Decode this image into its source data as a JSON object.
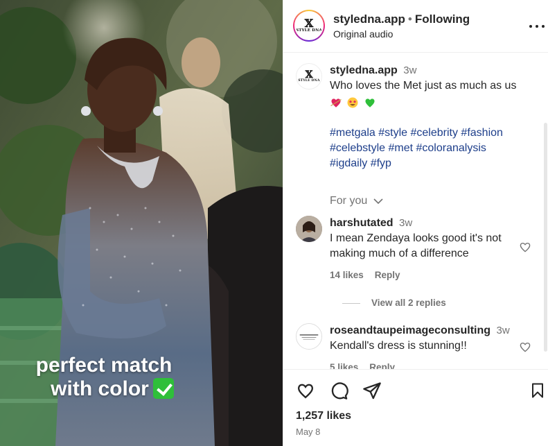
{
  "media": {
    "overlay_line1": "perfect match",
    "overlay_line2": "with color",
    "overlay_emoji": "check-mark-button"
  },
  "header": {
    "username": "styledna.app",
    "separator": "•",
    "follow_state": "Following",
    "audio": "Original audio",
    "logo_text": "STYLE DNA",
    "logo_mark": "ẍ"
  },
  "post": {
    "username": "styledna.app",
    "time": "3w",
    "text": "Who loves the Met just as much as us",
    "emojis": [
      "heart-with-arrow",
      "star-struck",
      "green-heart"
    ],
    "hashtags_line1": "#metgala #style #celebrity #fashion",
    "hashtags_line2": "#celebstyle #met #coloranalysis",
    "hashtags_line3": "#igdaily #fyp",
    "for_you": "For you"
  },
  "comments": [
    {
      "username": "harshutated",
      "time": "3w",
      "text": "I mean Zendaya looks good it's not making much of a difference",
      "likes": "14 likes",
      "reply": "Reply",
      "view_replies": "View all 2 replies"
    },
    {
      "username": "roseandtaupeimageconsulting",
      "time": "3w",
      "text": "Kendall's dress is stunning!!",
      "likes": "5 likes",
      "reply": "Reply"
    }
  ],
  "footer": {
    "likes": "1,257 likes",
    "date": "May 8"
  },
  "colors": {
    "accent_link": "#1d3e8a",
    "muted": "#737373",
    "text": "#262626"
  }
}
